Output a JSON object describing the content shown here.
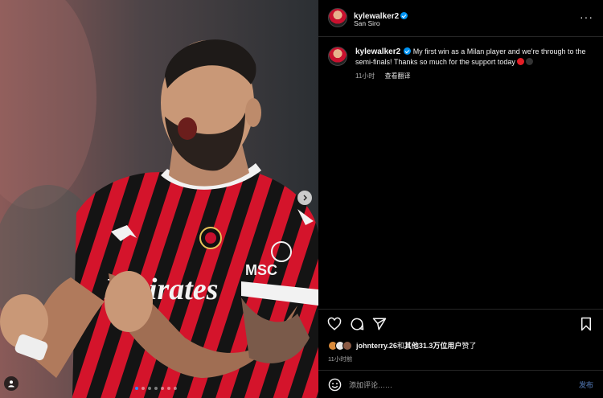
{
  "post": {
    "username": "kylewalker2",
    "location": "San Siro",
    "caption": "My first win as a Milan player and we're through to the semi-finals! Thanks so much for the support today",
    "caption_time": "11小时",
    "translate_label": "查看翻译",
    "likes_prefix": "johnterry.26",
    "likes_middle": "和",
    "likes_suffix": "其他31.3万位用户",
    "likes_end": "赞了",
    "time": "11小时前",
    "comment_placeholder": "添加评论……",
    "post_label": "发布",
    "more_label": "···"
  },
  "media": {
    "slide_count": 7,
    "active_slide": 1,
    "shirt_sponsor": "Emirates",
    "icons": [
      "chevron-right-icon",
      "user-tag-icon"
    ]
  },
  "icons": [
    "heart-icon",
    "comment-icon",
    "share-icon",
    "bookmark-icon",
    "emoji-icon",
    "verified-icon",
    "more-icon"
  ],
  "colors": {
    "background": "#000000",
    "text": "#f5f5f5",
    "secondary": "#a8a8a8",
    "verified": "#0095f6",
    "post_disabled": "#3d5a87",
    "milan_red": "#c8102e"
  }
}
